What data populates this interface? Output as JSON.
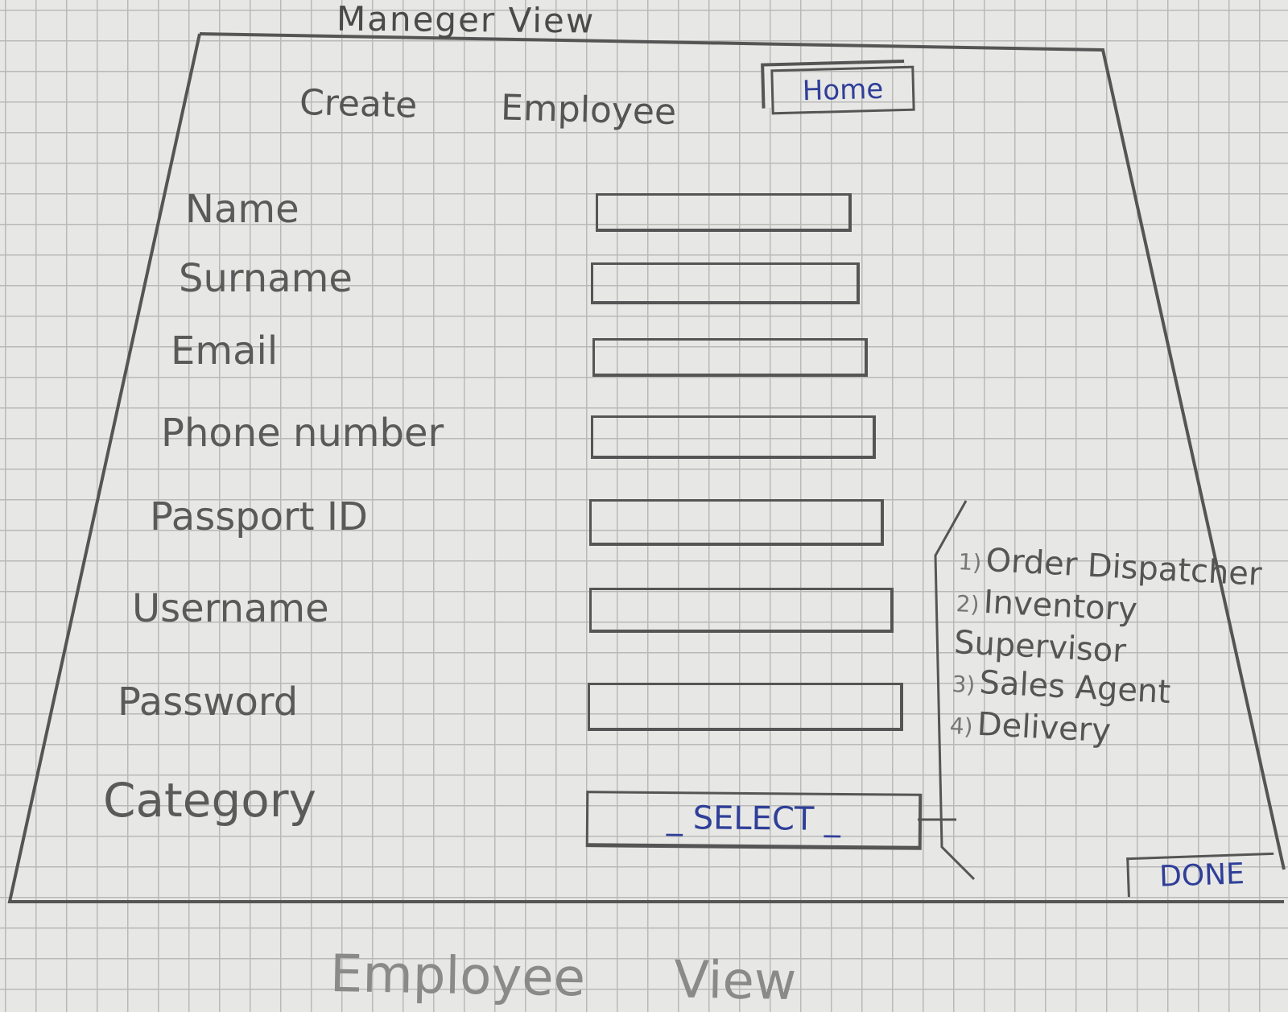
{
  "page_title": "Maneger View",
  "nav": {
    "home_label": "Home"
  },
  "form": {
    "heading": "Create Employee",
    "fields": [
      {
        "label": "Name"
      },
      {
        "label": "Surname"
      },
      {
        "label": "Email"
      },
      {
        "label": "Phone number"
      },
      {
        "label": "Passport ID"
      },
      {
        "label": "Username"
      },
      {
        "label": "Password"
      }
    ],
    "category": {
      "label": "Category",
      "selected": "_ SELECT _",
      "options": [
        {
          "num": "1)",
          "label": "Order Dispatcher"
        },
        {
          "num": "2)",
          "label": "Inventory Supervisor"
        },
        {
          "num": "3)",
          "label": "Sales Agent"
        },
        {
          "num": "4)",
          "label": "Delivery"
        }
      ]
    },
    "done_label": "DONE"
  },
  "footer_note": "Employee View"
}
